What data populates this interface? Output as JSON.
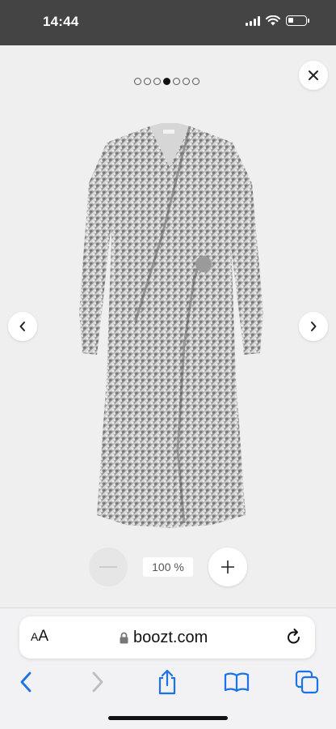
{
  "status_bar": {
    "time": "14:44",
    "icons": [
      "signal-icon",
      "wifi-icon",
      "battery-icon"
    ]
  },
  "gallery": {
    "total_images": 7,
    "active_index": 3,
    "image_alt": "sequined wrap dress",
    "zoom_level": "100 %",
    "icons": {
      "close": "close-icon",
      "previous": "chevron-left-icon",
      "next": "chevron-right-icon",
      "zoom_out": "minus-icon",
      "zoom_in": "plus-icon"
    }
  },
  "browser": {
    "text_size_label_small": "A",
    "text_size_label_large": "A",
    "url": "boozt.com",
    "accent_color": "#1a73e8",
    "toolbar_icons": [
      "back-icon",
      "forward-icon",
      "share-icon",
      "bookmarks-icon",
      "tabs-icon"
    ]
  }
}
